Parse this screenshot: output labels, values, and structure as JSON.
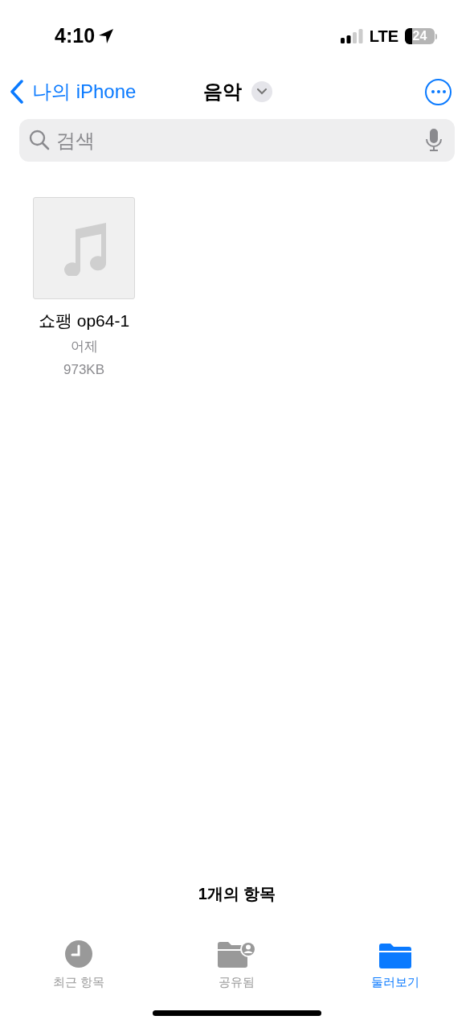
{
  "status_bar": {
    "time": "4:10",
    "network": "LTE",
    "battery": "24"
  },
  "nav": {
    "back": "나의 iPhone",
    "title": "음악"
  },
  "search": {
    "placeholder": "검색"
  },
  "files": [
    {
      "kind": "audio",
      "name": "쇼팽 op64-1",
      "date": "어제",
      "size": "973KB"
    }
  ],
  "footer": {
    "count": "1개의 항목"
  },
  "tabs": [
    {
      "kind": "clock",
      "label": "최근 항목",
      "selected": false
    },
    {
      "kind": "shared",
      "label": "공유됨",
      "selected": false
    },
    {
      "kind": "folder",
      "label": "둘러보기",
      "selected": true
    }
  ]
}
